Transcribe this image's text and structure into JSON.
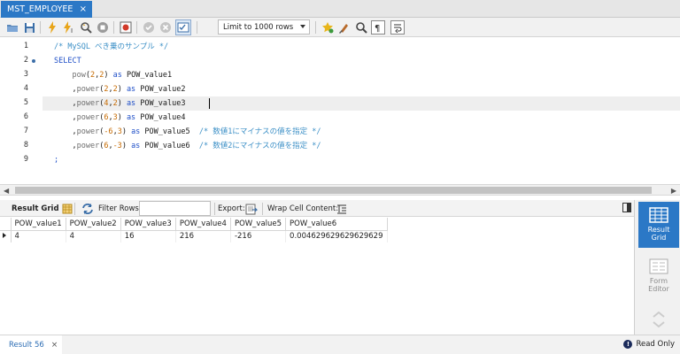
{
  "tab": {
    "title": "MST_EMPLOYEE",
    "close": "×"
  },
  "toolbar": {
    "limit_label": "Limit to 1000 rows"
  },
  "editor": {
    "lines": [
      {
        "num": "1",
        "tokens": [
          {
            "t": "/* MySQL べき乗のサンプル */",
            "c": "cm"
          }
        ]
      },
      {
        "num": "2",
        "tokens": [
          {
            "t": "SELECT",
            "c": "kw"
          }
        ]
      },
      {
        "num": "3",
        "tokens": [
          {
            "t": "    "
          },
          {
            "t": "pow",
            "c": "fn"
          },
          {
            "t": "("
          },
          {
            "t": "2",
            "c": "num"
          },
          {
            "t": ","
          },
          {
            "t": "2",
            "c": "num"
          },
          {
            "t": ") "
          },
          {
            "t": "as",
            "c": "kw"
          },
          {
            "t": " POW_value1",
            "c": "id"
          }
        ]
      },
      {
        "num": "4",
        "tokens": [
          {
            "t": "    ,"
          },
          {
            "t": "power",
            "c": "fn"
          },
          {
            "t": "("
          },
          {
            "t": "2",
            "c": "num"
          },
          {
            "t": ","
          },
          {
            "t": "2",
            "c": "num"
          },
          {
            "t": ") "
          },
          {
            "t": "as",
            "c": "kw"
          },
          {
            "t": " POW_value2",
            "c": "id"
          }
        ]
      },
      {
        "num": "5",
        "tokens": [
          {
            "t": "    ,"
          },
          {
            "t": "power",
            "c": "fn"
          },
          {
            "t": "("
          },
          {
            "t": "4",
            "c": "num"
          },
          {
            "t": ","
          },
          {
            "t": "2",
            "c": "num"
          },
          {
            "t": ") "
          },
          {
            "t": "as",
            "c": "kw"
          },
          {
            "t": " POW_value3",
            "c": "id"
          }
        ]
      },
      {
        "num": "6",
        "tokens": [
          {
            "t": "    ,"
          },
          {
            "t": "power",
            "c": "fn"
          },
          {
            "t": "("
          },
          {
            "t": "6",
            "c": "num"
          },
          {
            "t": ","
          },
          {
            "t": "3",
            "c": "num"
          },
          {
            "t": ") "
          },
          {
            "t": "as",
            "c": "kw"
          },
          {
            "t": " POW_value4",
            "c": "id"
          }
        ]
      },
      {
        "num": "7",
        "tokens": [
          {
            "t": "    ,"
          },
          {
            "t": "power",
            "c": "fn"
          },
          {
            "t": "("
          },
          {
            "t": "-6",
            "c": "num"
          },
          {
            "t": ","
          },
          {
            "t": "3",
            "c": "num"
          },
          {
            "t": ") "
          },
          {
            "t": "as",
            "c": "kw"
          },
          {
            "t": " POW_value5  ",
            "c": "id"
          },
          {
            "t": "/* 数値1にマイナスの値を指定 */",
            "c": "cm"
          }
        ]
      },
      {
        "num": "8",
        "tokens": [
          {
            "t": "    ,"
          },
          {
            "t": "power",
            "c": "fn"
          },
          {
            "t": "("
          },
          {
            "t": "6",
            "c": "num"
          },
          {
            "t": ","
          },
          {
            "t": "-3",
            "c": "num"
          },
          {
            "t": ") "
          },
          {
            "t": "as",
            "c": "kw"
          },
          {
            "t": " POW_value6  ",
            "c": "id"
          },
          {
            "t": "/* 数値2にマイナスの値を指定 */",
            "c": "cm"
          }
        ]
      },
      {
        "num": "9",
        "tokens": [
          {
            "t": ";",
            "c": "kw"
          }
        ]
      }
    ]
  },
  "results_toolbar": {
    "result_grid": "Result Grid",
    "filter_rows": "Filter Rows:",
    "export": "Export:",
    "wrap_cell": "Wrap Cell Content:"
  },
  "grid": {
    "columns": [
      "POW_value1",
      "POW_value2",
      "POW_value3",
      "POW_value4",
      "POW_value5",
      "POW_value6"
    ],
    "rows": [
      [
        "4",
        "4",
        "16",
        "216",
        "-216",
        "0.004629629629629629"
      ]
    ]
  },
  "side_panel": {
    "result_grid": "Result Grid",
    "form_editor": "Form Editor"
  },
  "bottom": {
    "result_tab": "Result 56",
    "close": "×",
    "read_only": "Read Only"
  },
  "colors": {
    "accent": "#2b78c6"
  }
}
